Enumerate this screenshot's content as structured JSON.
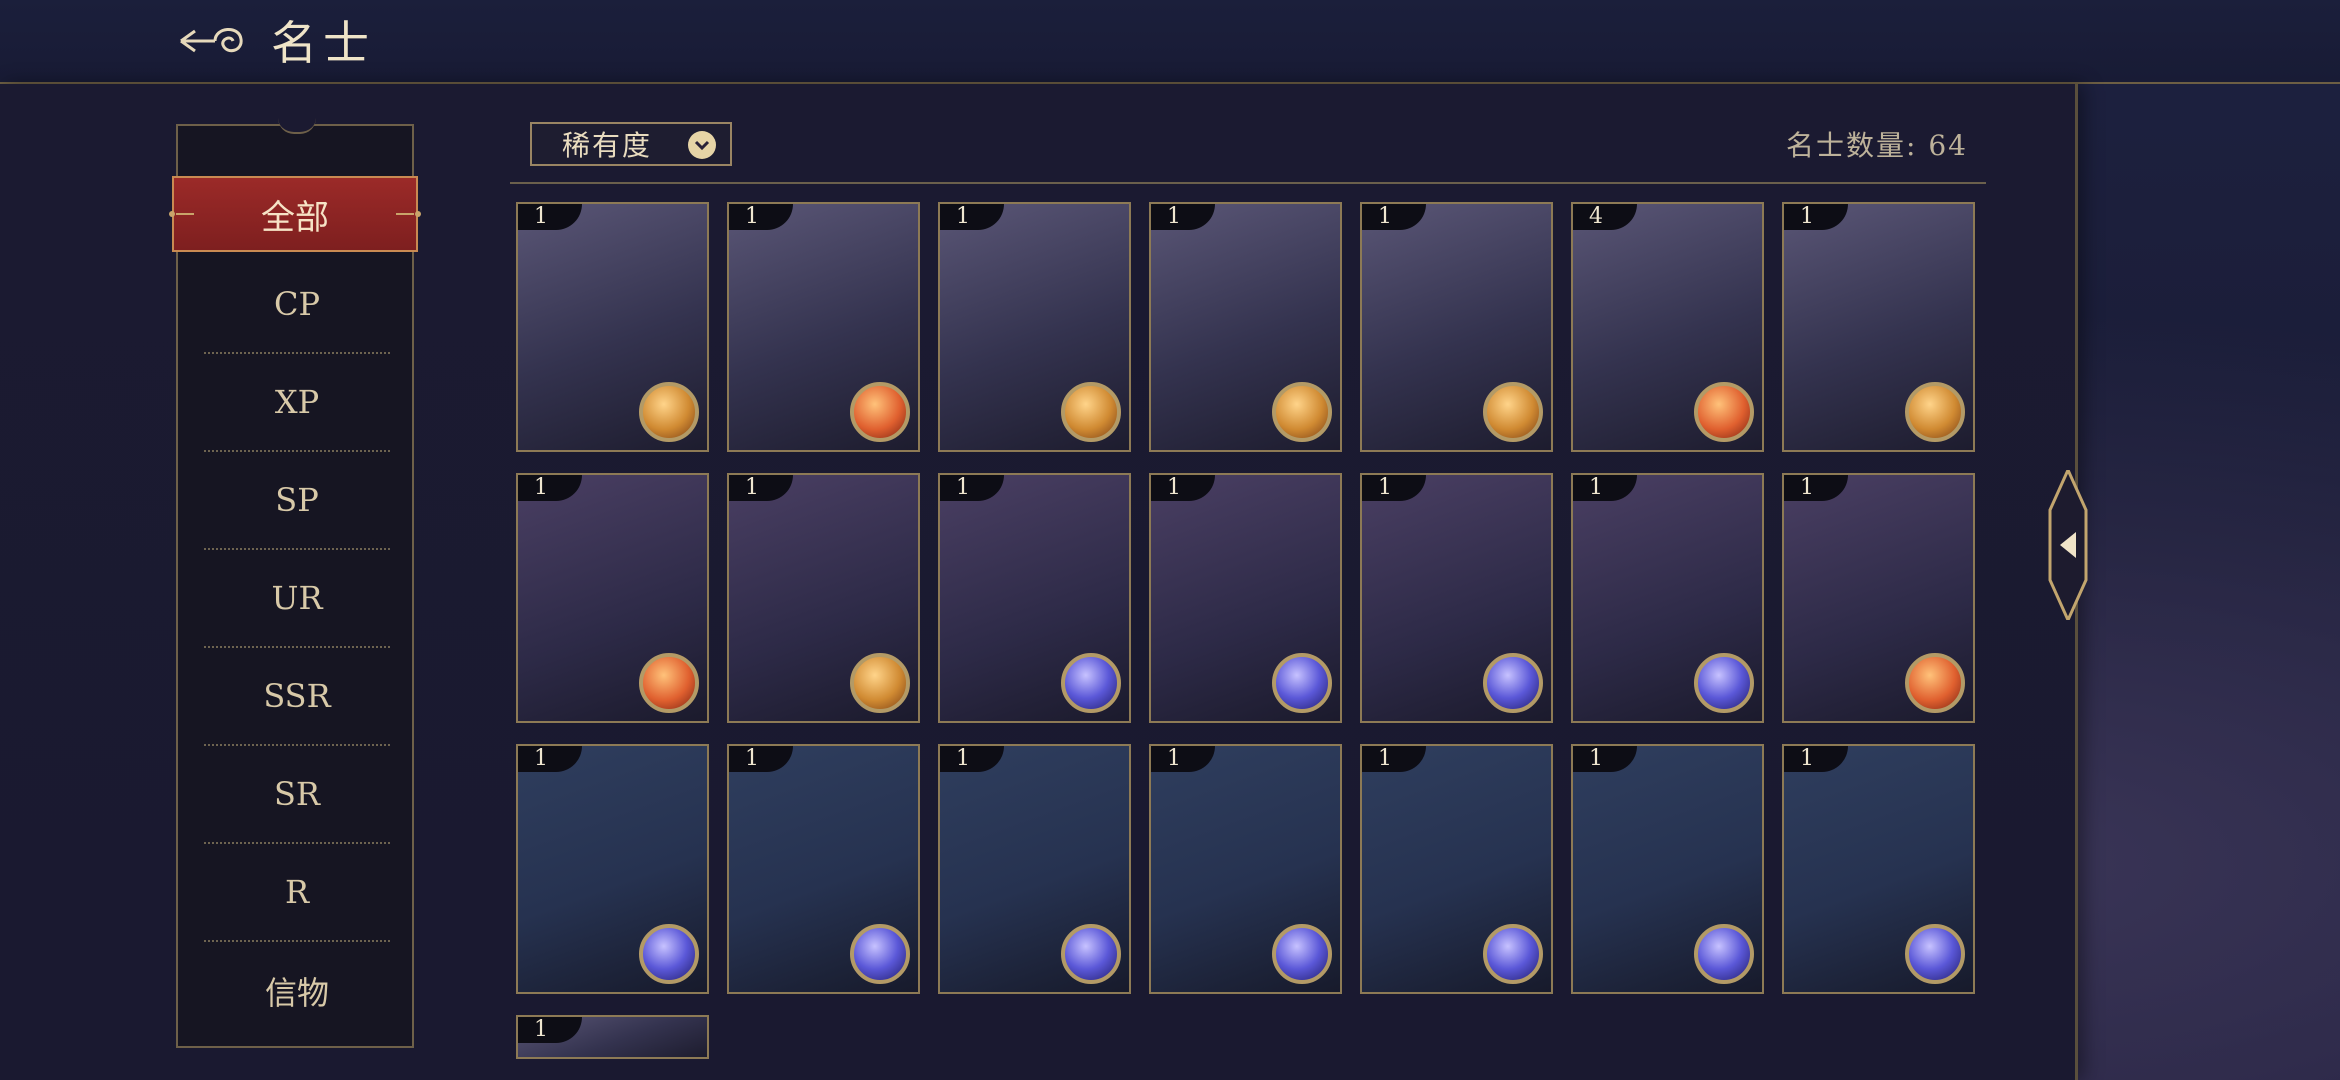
{
  "header": {
    "title": "名士"
  },
  "menu": {
    "active": "全部",
    "items": [
      "CP",
      "XP",
      "SP",
      "UR",
      "SSR",
      "SR",
      "R",
      "信物"
    ]
  },
  "filter": {
    "label": "稀有度"
  },
  "count": {
    "text": "名士数量: 64"
  },
  "cards": [
    {
      "badge": "1",
      "orb": "gold"
    },
    {
      "badge": "1",
      "orb": "red"
    },
    {
      "badge": "1",
      "orb": "gold"
    },
    {
      "badge": "1",
      "orb": "gold"
    },
    {
      "badge": "1",
      "orb": "gold"
    },
    {
      "badge": "4",
      "orb": "red"
    },
    {
      "badge": "1",
      "orb": "gold"
    },
    {
      "badge": "1",
      "orb": "red"
    },
    {
      "badge": "1",
      "orb": "gold"
    },
    {
      "badge": "1",
      "orb": "blue"
    },
    {
      "badge": "1",
      "orb": "blue"
    },
    {
      "badge": "1",
      "orb": "blue"
    },
    {
      "badge": "1",
      "orb": "blue"
    },
    {
      "badge": "1",
      "orb": "red"
    },
    {
      "badge": "1",
      "orb": "blue"
    },
    {
      "badge": "1",
      "orb": "blue"
    },
    {
      "badge": "1",
      "orb": "blue"
    },
    {
      "badge": "1",
      "orb": "blue"
    },
    {
      "badge": "1",
      "orb": "blue"
    },
    {
      "badge": "1",
      "orb": "blue"
    },
    {
      "badge": "1",
      "orb": "blue"
    },
    {
      "badge": "1",
      "orb": "none"
    }
  ],
  "colors": {
    "accent": "#9b2a28",
    "gold": "#c9a46a",
    "panel": "#1b1a31"
  }
}
